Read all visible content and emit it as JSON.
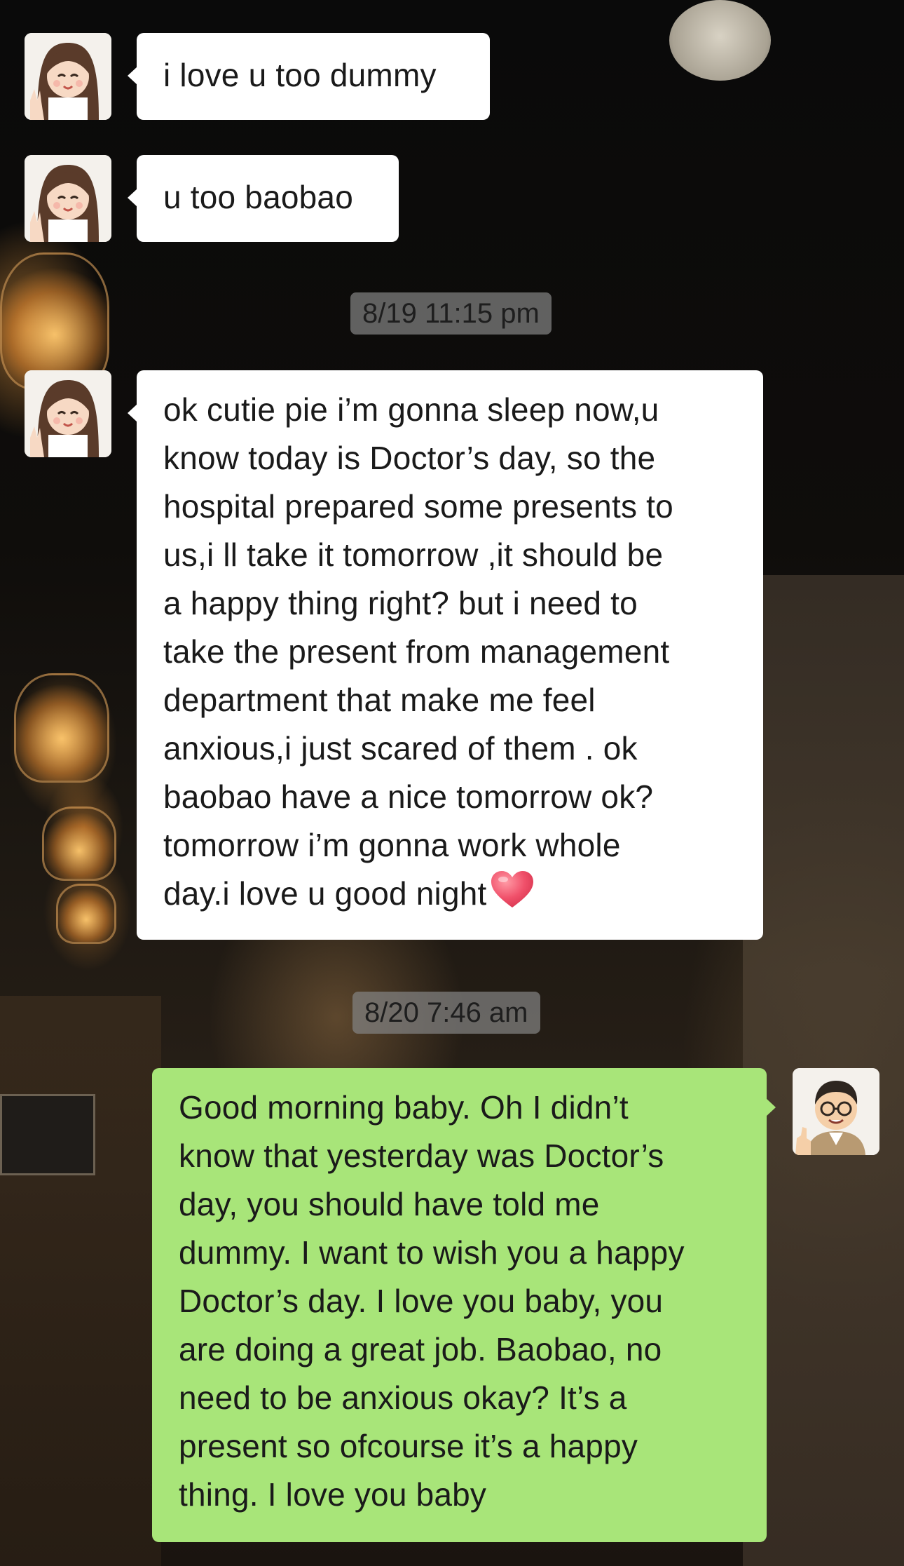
{
  "chat": {
    "messages": [
      {
        "from": "contact",
        "lines": [
          "i love u too dummy"
        ]
      },
      {
        "from": "contact",
        "lines": [
          "u too baobao"
        ]
      },
      {
        "from": "contact",
        "lines": [
          "ok cutie pie i’m gonna sleep now,u",
          "know today is Doctor’s day, so the",
          "hospital prepared some presents to",
          "us,i ll take it tomorrow ,it should be",
          "a happy thing right? but i need to",
          "take the present from management",
          "department that make me feel",
          "anxious,i just scared of them . ok",
          "baobao have a nice tomorrow ok?",
          "tomorrow i’m gonna work whole",
          "day.i love u good night"
        ],
        "emoji": "heart-emoji"
      },
      {
        "from": "me",
        "lines": [
          "Good morning baby. Oh I didn’t",
          "know that yesterday was Doctor’s",
          "day, you should have told me",
          "dummy. I want to wish you a happy",
          "Doctor’s day. I love you baby, you",
          "are doing a great job. Baobao, no",
          "need to be anxious okay? It’s a",
          "present so ofcourse it’s a happy",
          "thing. I love you baby"
        ]
      }
    ],
    "timestamps": [
      "8/19 11:15 pm",
      "8/20 7:46 am"
    ]
  },
  "avatars": {
    "contact": "cartoon-girl-doctor-avatar",
    "me": "cartoon-man-glasses-avatar"
  },
  "colors": {
    "incoming_bubble": "#ffffff",
    "outgoing_bubble": "#a8e579",
    "timestamp_bg": "#8a8a8a",
    "text": "#1a1a1a"
  }
}
